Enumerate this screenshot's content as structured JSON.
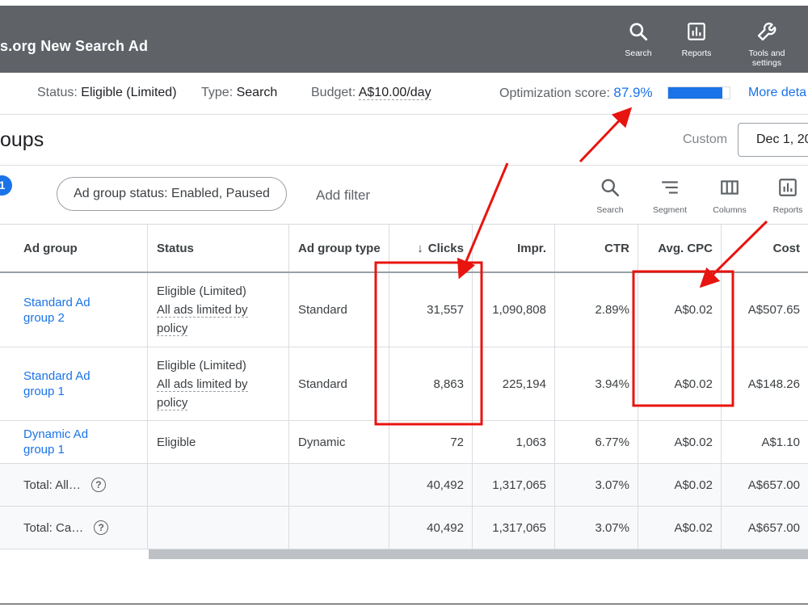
{
  "topbar": {
    "campaign_name": "s.org New Search Ad",
    "buttons": [
      {
        "label": "Search",
        "icon": "search-icon"
      },
      {
        "label": "Reports",
        "icon": "reports-icon"
      },
      {
        "label": "Tools and settings",
        "icon": "wrench-icon"
      }
    ]
  },
  "statusbar": {
    "status_label": "Status:",
    "status_value": "Eligible (Limited)",
    "type_label": "Type:",
    "type_value": "Search",
    "budget_label": "Budget:",
    "budget_value": "A$10.00/day",
    "opt_label": "Optimization score:",
    "opt_value": "87.9%",
    "opt_fraction": 0.879,
    "more_details": "More deta"
  },
  "title": {
    "page_title": "oups",
    "custom_label": "Custom",
    "date_value": "Dec 1, 20"
  },
  "filters": {
    "badge_count": "1",
    "chip_label": "Ad group status: Enabled, Paused",
    "add_filter": "Add filter",
    "tools": [
      {
        "label": "Search",
        "icon": "search-icon"
      },
      {
        "label": "Segment",
        "icon": "segment-icon"
      },
      {
        "label": "Columns",
        "icon": "columns-icon"
      },
      {
        "label": "Reports",
        "icon": "reports-icon"
      }
    ]
  },
  "table": {
    "headers": {
      "ad_group": "Ad group",
      "status": "Status",
      "ad_group_type": "Ad group type",
      "clicks": "Clicks",
      "impr": "Impr.",
      "ctr": "CTR",
      "avg_cpc": "Avg. CPC",
      "cost": "Cost"
    },
    "rows": [
      {
        "name_line1": "Standard Ad",
        "name_line2": "group 2",
        "status_line1": "Eligible (Limited)",
        "status_line2": "All ads limited by",
        "status_line3": "policy",
        "type": "Standard",
        "clicks": "31,557",
        "impr": "1,090,808",
        "ctr": "2.89%",
        "avg_cpc": "A$0.02",
        "cost": "A$507.65"
      },
      {
        "name_line1": "Standard Ad",
        "name_line2": "group 1",
        "status_line1": "Eligible (Limited)",
        "status_line2": "All ads limited by",
        "status_line3": "policy",
        "type": "Standard",
        "clicks": "8,863",
        "impr": "225,194",
        "ctr": "3.94%",
        "avg_cpc": "A$0.02",
        "cost": "A$148.26"
      },
      {
        "name_line1": "Dynamic Ad",
        "name_line2": "group 1",
        "status_line1": "Eligible",
        "type": "Dynamic",
        "clicks": "72",
        "impr": "1,063",
        "ctr": "6.77%",
        "avg_cpc": "A$0.02",
        "cost": "A$1.10"
      }
    ],
    "totals": [
      {
        "label": "Total: All…",
        "clicks": "40,492",
        "impr": "1,317,065",
        "ctr": "3.07%",
        "avg_cpc": "A$0.02",
        "cost": "A$657.00"
      },
      {
        "label": "Total: Ca…",
        "clicks": "40,492",
        "impr": "1,317,065",
        "ctr": "3.07%",
        "avg_cpc": "A$0.02",
        "cost": "A$657.00"
      }
    ]
  },
  "annotation_color": "#e8140f"
}
